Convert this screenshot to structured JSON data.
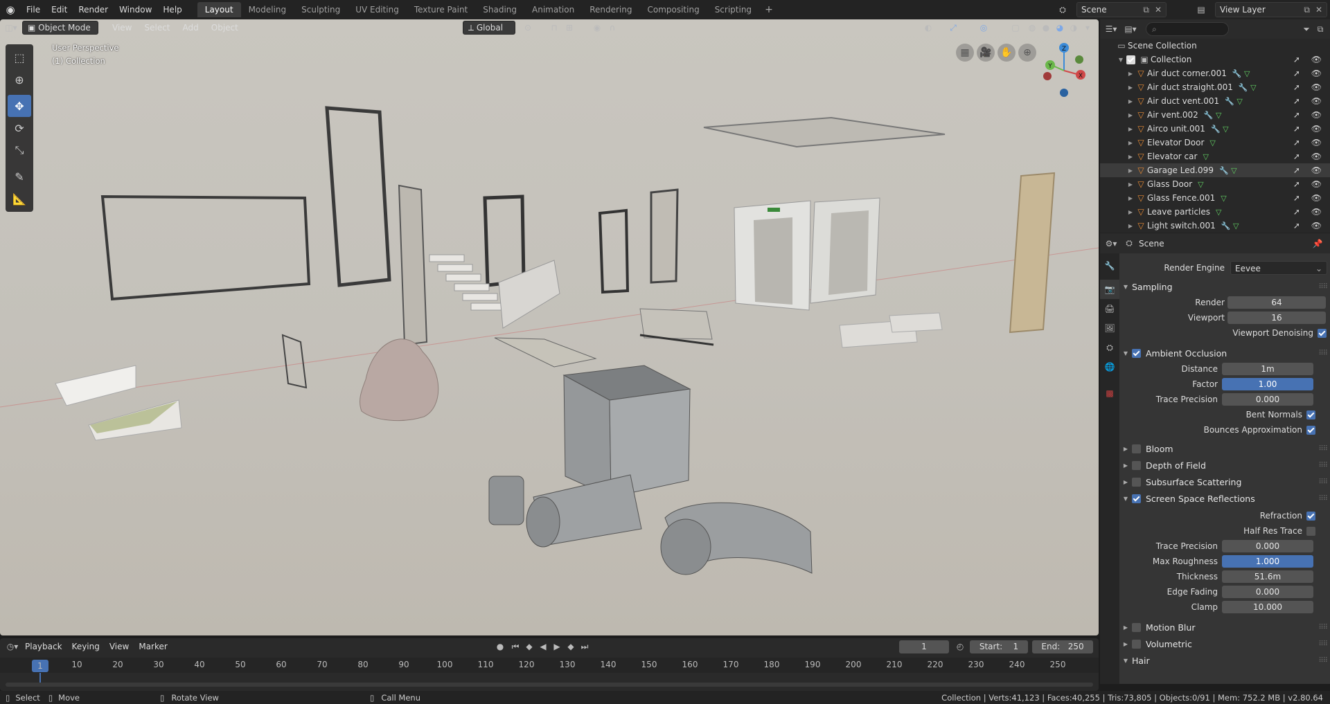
{
  "menubar": {
    "items": [
      "File",
      "Edit",
      "Render",
      "Window",
      "Help"
    ],
    "workspaces": [
      "Layout",
      "Modeling",
      "Sculpting",
      "UV Editing",
      "Texture Paint",
      "Shading",
      "Animation",
      "Rendering",
      "Compositing",
      "Scripting"
    ],
    "active_workspace": "Layout",
    "scene": "Scene",
    "view_layer": "View Layer"
  },
  "viewport": {
    "mode": "Object Mode",
    "menus": [
      "View",
      "Select",
      "Add",
      "Object"
    ],
    "transform_orientation": "Global",
    "perspective_label": "User Perspective",
    "collection_label": "(1) Collection",
    "axis": {
      "x": "X",
      "y": "Y",
      "z": "Z"
    }
  },
  "outliner": {
    "search_placeholder": "",
    "root": "Scene Collection",
    "collection": "Collection",
    "items": [
      {
        "label": "Air duct corner.001",
        "wrench": true
      },
      {
        "label": "Air duct straight.001",
        "wrench": true
      },
      {
        "label": "Air duct vent.001",
        "wrench": true
      },
      {
        "label": "Air vent.002",
        "wrench": true
      },
      {
        "label": "Airco unit.001",
        "wrench": true
      },
      {
        "label": "Elevator Door",
        "wrench": false
      },
      {
        "label": "Elevator car",
        "wrench": false
      },
      {
        "label": "Garage Led.099",
        "wrench": true,
        "selected": true
      },
      {
        "label": "Glass Door",
        "wrench": false
      },
      {
        "label": "Glass Fence.001",
        "wrench": false
      },
      {
        "label": "Leave particles",
        "wrench": false
      },
      {
        "label": "Light switch.001",
        "wrench": true
      }
    ]
  },
  "properties": {
    "context": "Scene",
    "render_engine_label": "Render Engine",
    "render_engine": "Eevee",
    "sampling": {
      "title": "Sampling",
      "render_label": "Render",
      "render": "64",
      "viewport_label": "Viewport",
      "viewport": "16",
      "denoise_label": "Viewport Denoising",
      "denoise": true
    },
    "ao": {
      "title": "Ambient Occlusion",
      "distance_label": "Distance",
      "distance": "1m",
      "factor_label": "Factor",
      "factor": "1.00",
      "trace_label": "Trace Precision",
      "trace": "0.000",
      "bent_label": "Bent Normals",
      "bounces_label": "Bounces Approximation"
    },
    "collapsed": [
      {
        "title": "Bloom",
        "checked": false
      },
      {
        "title": "Depth of Field",
        "checked": false
      },
      {
        "title": "Subsurface Scattering",
        "checked": false
      }
    ],
    "ssr": {
      "title": "Screen Space Reflections",
      "refraction_label": "Refraction",
      "halfres_label": "Half Res Trace",
      "trace_label": "Trace Precision",
      "trace": "0.000",
      "maxrough_label": "Max Roughness",
      "maxrough": "1.000",
      "thickness_label": "Thickness",
      "thickness": "51.6m",
      "edgefade_label": "Edge Fading",
      "edgefade": "0.000",
      "clamp_label": "Clamp",
      "clamp": "10.000"
    },
    "collapsed2": [
      {
        "title": "Motion Blur",
        "checked": false
      },
      {
        "title": "Volumetric",
        "checked": false
      }
    ],
    "hair_title": "Hair"
  },
  "timeline": {
    "menus": [
      "Playback",
      "Keying",
      "View",
      "Marker"
    ],
    "current_frame": "1",
    "start_label": "Start:",
    "start": "1",
    "end_label": "End:",
    "end": "250",
    "ruler": [
      "1",
      "10",
      "20",
      "30",
      "40",
      "50",
      "60",
      "70",
      "80",
      "90",
      "100",
      "110",
      "120",
      "130",
      "140",
      "150",
      "160",
      "170",
      "180",
      "190",
      "200",
      "210",
      "220",
      "230",
      "240",
      "250"
    ]
  },
  "statusbar": {
    "select": "Select",
    "move": "Move",
    "rotate": "Rotate View",
    "callmenu": "Call Menu",
    "stats": "Collection | Verts:41,123 | Faces:40,255 | Tris:73,805 | Objects:0/91 | Mem: 752.2 MB | v2.80.64"
  },
  "colors": {
    "accent": "#4772b3",
    "object": "#e88b35",
    "modifier": "#6c9be0",
    "mesh": "#62d063"
  }
}
